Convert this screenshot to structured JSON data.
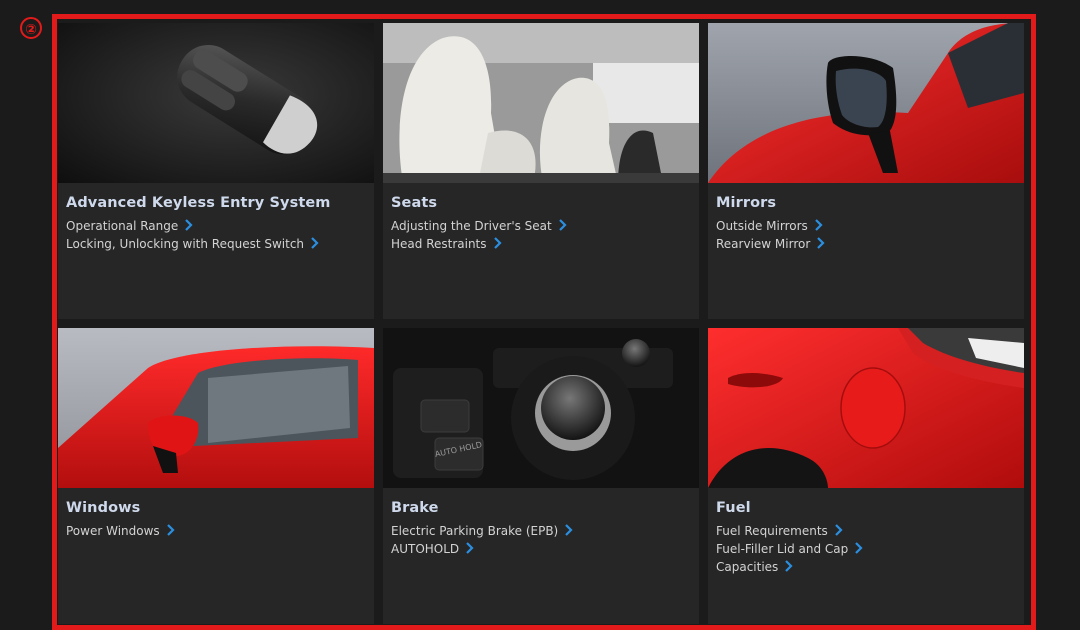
{
  "marker": "②",
  "cards": [
    {
      "title": "Advanced Keyless Entry System",
      "links": [
        "Operational Range",
        "Locking, Unlocking with Request Switch"
      ]
    },
    {
      "title": "Seats",
      "links": [
        "Adjusting the Driver's Seat",
        "Head Restraints"
      ]
    },
    {
      "title": "Mirrors",
      "links": [
        "Outside Mirrors",
        "Rearview Mirror"
      ]
    },
    {
      "title": "Windows",
      "links": [
        "Power Windows"
      ]
    },
    {
      "title": "Brake",
      "links": [
        "Electric Parking Brake (EPB)",
        "AUTOHOLD"
      ]
    },
    {
      "title": "Fuel",
      "links": [
        "Fuel Requirements",
        "Fuel-Filler Lid and Cap",
        "Capacities"
      ]
    }
  ],
  "button_labels": {
    "auto_hold": "AUTO HOLD"
  },
  "colors": {
    "accent_red": "#e21a1a",
    "link_chevron": "#2a8fe0",
    "card_bg": "#262626",
    "title": "#cfd9ec"
  }
}
